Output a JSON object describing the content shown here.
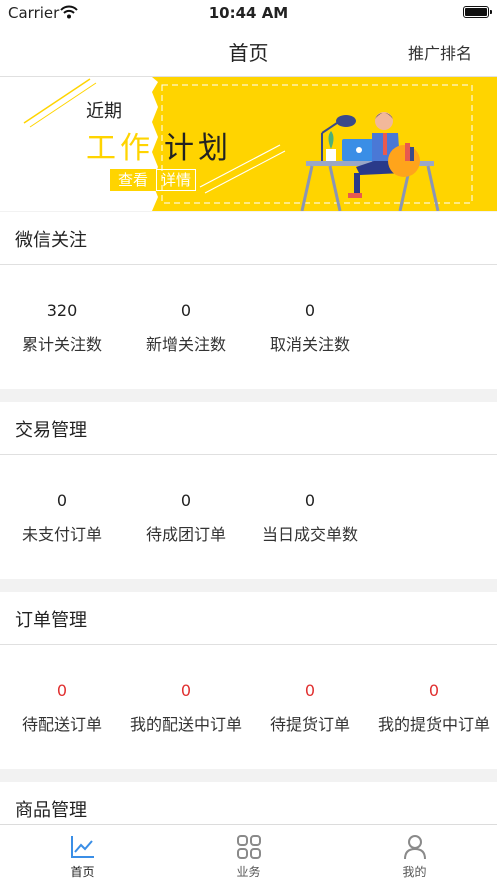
{
  "status_bar": {
    "carrier": "Carrier",
    "time": "10:44 AM"
  },
  "header": {
    "title": "首页",
    "right_action": "推广排名"
  },
  "banner": {
    "small_title": "近期",
    "title_part1": "工作",
    "title_part2": "计划",
    "button_left": "查看",
    "button_right": "详情"
  },
  "sections": {
    "wechat": {
      "title": "微信关注",
      "stats": [
        {
          "value": "320",
          "label": "累计关注数"
        },
        {
          "value": "0",
          "label": "新增关注数"
        },
        {
          "value": "0",
          "label": "取消关注数"
        }
      ]
    },
    "trade": {
      "title": "交易管理",
      "stats": [
        {
          "value": "0",
          "label": "未支付订单"
        },
        {
          "value": "0",
          "label": "待成团订单"
        },
        {
          "value": "0",
          "label": "当日成交单数"
        }
      ]
    },
    "orders": {
      "title": "订单管理",
      "stats": [
        {
          "value": "0",
          "label": "待配送订单"
        },
        {
          "value": "0",
          "label": "我的配送中订单"
        },
        {
          "value": "0",
          "label": "待提货订单"
        },
        {
          "value": "0",
          "label": "我的提货中订单"
        }
      ]
    },
    "goods": {
      "title": "商品管理"
    }
  },
  "tabbar": {
    "tabs": [
      {
        "label": "首页",
        "icon": "line-chart-icon",
        "active": true
      },
      {
        "label": "业务",
        "icon": "grid-icon",
        "active": false
      },
      {
        "label": "我的",
        "icon": "user-icon",
        "active": false
      }
    ]
  },
  "colors": {
    "banner_yellow": "#ffd400",
    "accent_blue": "#3a8ee6",
    "alert_red": "#e03030",
    "background": "#f2f2f2"
  }
}
